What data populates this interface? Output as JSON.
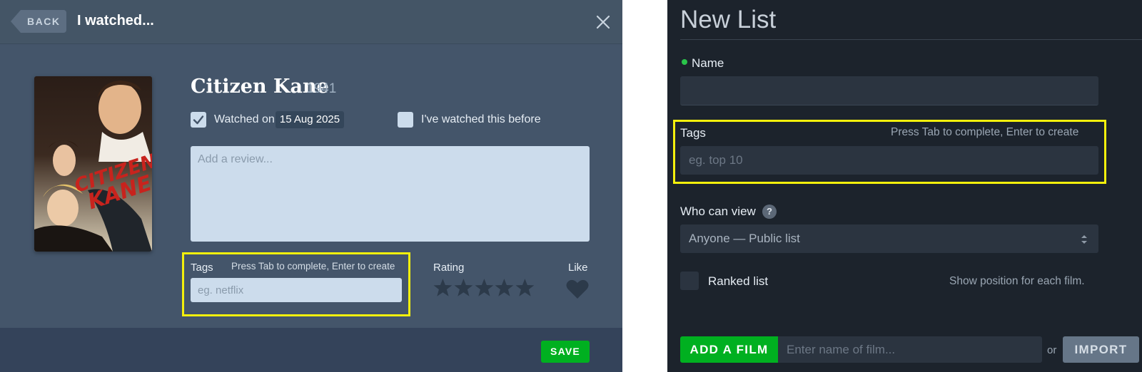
{
  "left_panel": {
    "header": {
      "back_label": "BACK",
      "title": "I watched..."
    },
    "film": {
      "title": "Citizen Kane",
      "year": "1941",
      "poster_text": [
        "CITIZEN",
        "KANE"
      ]
    },
    "watched": {
      "checked": true,
      "label": "Watched on",
      "date": "15 Aug 2025"
    },
    "watched_before": {
      "checked": false,
      "label": "I've watched this before"
    },
    "review": {
      "placeholder": "Add a review..."
    },
    "tags": {
      "label": "Tags",
      "hint": "Press Tab to complete, Enter to create",
      "placeholder": "eg. netflix"
    },
    "rating": {
      "label": "Rating",
      "value": 0,
      "max": 5
    },
    "like": {
      "label": "Like",
      "liked": false
    },
    "footer": {
      "save_label": "SAVE"
    }
  },
  "right_panel": {
    "title": "New List",
    "name": {
      "label": "Name",
      "value": ""
    },
    "tags": {
      "label": "Tags",
      "hint": "Press Tab to complete, Enter to create",
      "placeholder": "eg. top 10"
    },
    "who_can_view": {
      "label": "Who can view",
      "help_glyph": "?",
      "selected": "Anyone — Public list"
    },
    "ranked": {
      "checked": false,
      "label": "Ranked list",
      "hint": "Show position for each film."
    },
    "add_film": {
      "button_label": "ADD A FILM",
      "placeholder": "Enter name of film...",
      "or_text": "or",
      "import_label": "IMPORT"
    }
  },
  "colors": {
    "accent_green": "#00b020",
    "highlight_yellow": "#f4f00c",
    "left_bg": "#44556a",
    "right_bg": "#1c232c"
  }
}
